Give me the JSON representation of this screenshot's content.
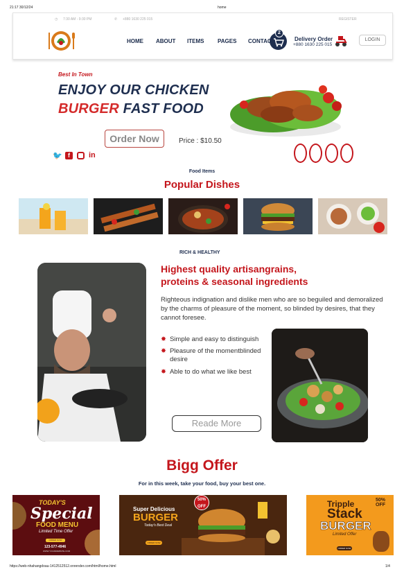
{
  "print": {
    "datetime": "21:17 30/12/24",
    "page_title": "home",
    "url": "https://web-nhahangdoau-1412512512.onrender.com/html/home.html",
    "page_num": "1/4"
  },
  "topinfo": {
    "hours": "7:30 AM - 9:30 PM",
    "phone": "+880 1630 225 015",
    "register": "REGISTER"
  },
  "nav": {
    "items": [
      "HOME",
      "ABOUT",
      "ITEMS",
      "PAGES",
      "CONTACT"
    ],
    "cart_count": "2",
    "delivery_title": "Delivery Order",
    "delivery_phone": "+880 1630 225 015",
    "login": "LOGIN"
  },
  "hero": {
    "tag": "Best In Town",
    "line1": "ENJOY OUR CHICKEN",
    "line2_red": "BURGER",
    "line2_rest": " FAST FOOD",
    "order_btn": "Order Now",
    "price": "Price : $10.50"
  },
  "dishes": {
    "subtitle": "Food Items",
    "title": "Popular Dishes"
  },
  "about": {
    "subtitle": "RICH & HEALTHY",
    "title_line1": "Highest quality artisangrains,",
    "title_line2": "proteins & seasonal ingredients",
    "paragraph": "Righteous indignation and dislike men who are so beguiled and demoralized by the charms of pleasure of the moment, so blinded by desires, that they cannot foresee.",
    "bullets": [
      "Simple and easy to distinguish",
      "Pleasure of the momentblinded desire",
      "Able to do what we like best"
    ],
    "readmore": "Reade More"
  },
  "offer": {
    "title": "Bigg Offer",
    "subtitle": "For in this week, take your food, buy your best one."
  },
  "banners": {
    "b1": {
      "line1": "TODAY'S",
      "line2": "Special",
      "line3": "FOOD MENU",
      "line4": "Limited Time Offer",
      "btn": "ORDER NOW",
      "phone": "123-577-4946",
      "site": "WWW.YOURWEBSITE.COM"
    },
    "b2": {
      "line1": "Super Delicious",
      "line2": "BURGER",
      "line3": "Today's Best Deal",
      "badge": "50% OFF",
      "btn": "ORDER NOW"
    },
    "b3": {
      "line1": "Tripple",
      "line2": "Stack",
      "line3": "BURGER",
      "line4": "Limited Offer",
      "badge": "50% OFF",
      "btn": "ORDER NOW"
    }
  },
  "colors": {
    "brand_red": "#c4161c",
    "navy": "#1e2e4f"
  }
}
